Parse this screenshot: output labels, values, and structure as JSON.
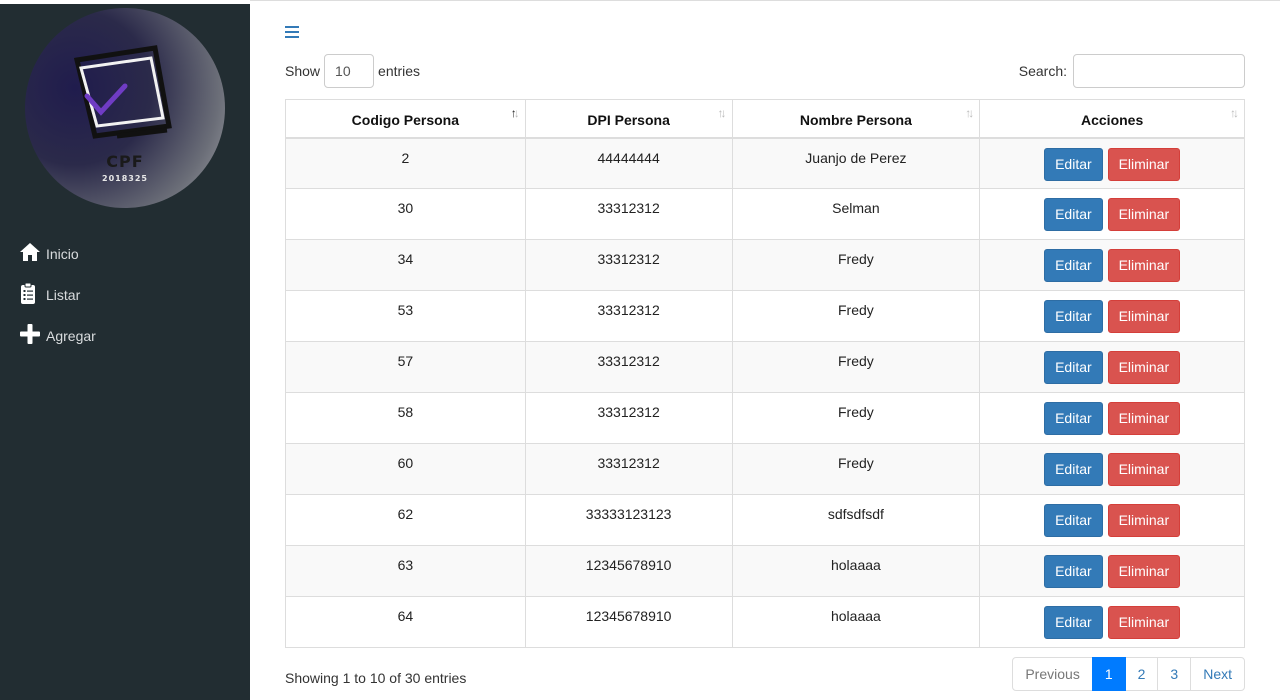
{
  "sidebar": {
    "logo_title": "CPF",
    "logo_subtitle": "2018325",
    "items": [
      {
        "label": "Inicio",
        "icon": "home-icon"
      },
      {
        "label": "Listar",
        "icon": "clipboard-list-icon"
      },
      {
        "label": "Agregar",
        "icon": "plus-icon"
      }
    ]
  },
  "controls": {
    "show_label": "Show",
    "entries_label": "entries",
    "page_length": "10",
    "search_label": "Search:",
    "search_value": ""
  },
  "table": {
    "headers": [
      "Codigo Persona",
      "DPI Persona",
      "Nombre Persona",
      "Acciones"
    ],
    "sorted_column": 0,
    "edit_label": "Editar",
    "delete_label": "Eliminar",
    "rows": [
      [
        "2",
        "44444444",
        "Juanjo de Perez"
      ],
      [
        "30",
        "33312312",
        "Selman"
      ],
      [
        "34",
        "33312312",
        "Fredy"
      ],
      [
        "53",
        "33312312",
        "Fredy"
      ],
      [
        "57",
        "33312312",
        "Fredy"
      ],
      [
        "58",
        "33312312",
        "Fredy"
      ],
      [
        "60",
        "33312312",
        "Fredy"
      ],
      [
        "62",
        "33333123123",
        "sdfsdfsdf"
      ],
      [
        "63",
        "12345678910",
        "holaaaa"
      ],
      [
        "64",
        "12345678910",
        "holaaaa"
      ]
    ]
  },
  "footer": {
    "info": "Showing 1 to 10 of 30 entries",
    "previous": "Previous",
    "pages": [
      "1",
      "2",
      "3"
    ],
    "current_page": "1",
    "next": "Next"
  },
  "colors": {
    "sidebar_bg": "#222d32",
    "edit_button": "#337ab7",
    "delete_button": "#d9534f",
    "active_page": "#007bff"
  }
}
